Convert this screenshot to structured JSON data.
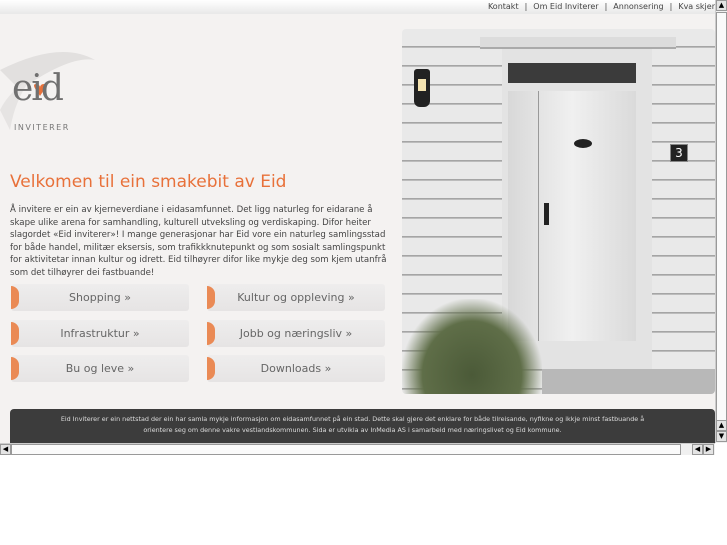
{
  "top_links": [
    "Kontakt",
    "Om Eid Inviterer",
    "Annonsering",
    "Kva skjer"
  ],
  "logo": {
    "word": "eid",
    "tagline": "INVITERER"
  },
  "title": "Velkomen til ein smakebit av Eid",
  "intro": "Å invitere er ein av kjerneverdiane i eidasamfunnet. Det ligg naturleg for eidarane å skape ulike arena for samhandling, kulturell utveksling og verdiskaping. Difor heiter slagordet «Eid inviterer»! I mange generasjonar har Eid vore ein naturleg samlingsstad for både handel, militær eksersis, som trafikkknutepunkt og som sosialt samlingspunkt for aktivitetar innan kultur og idrett. Eid tilhøyrer difor like mykje deg som kjem utanfrå som det tilhøyrer dei fastbuande!",
  "buttons": [
    "Shopping »",
    "Kultur og oppleving »",
    "Infrastruktur »",
    "Jobb og næringsliv »",
    "Bu og leve »",
    "Downloads »"
  ],
  "photo": {
    "house_number": "3"
  },
  "footer": "Eid Inviterer er ein nettstad der ein har samla mykje informasjon om eidasamfunnet på ein stad. Dette skal gjere det enklare for både tilreisande, nyfikne og ikkje minst fastbuande å orientere seg om denne vakre vestlandskommunen. Sida er utvikla av InMedia AS i samarbeid med næringslivet og Eid kommune.",
  "colors": {
    "accent": "#e8713a",
    "footer_bg": "#3c3c3c"
  }
}
